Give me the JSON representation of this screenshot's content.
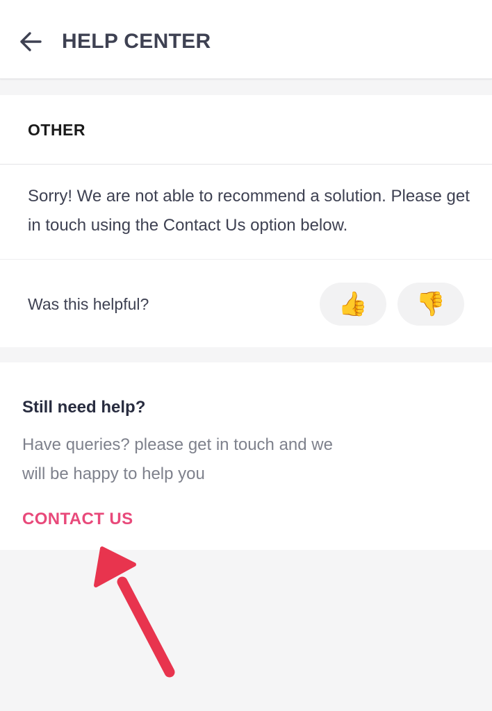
{
  "header": {
    "back_icon": "arrow-left-icon",
    "title": "HELP CENTER"
  },
  "article": {
    "section_title": "OTHER",
    "message": "Sorry! We are not able to recommend a solution. Please get in touch using the Contact Us option below."
  },
  "feedback": {
    "question": "Was this helpful?",
    "thumbs_up_icon": "👍",
    "thumbs_down_icon": "👎"
  },
  "support": {
    "title": "Still need help?",
    "description_line1": "Have queries? please get in touch and we",
    "description_line2": "will be happy to help you",
    "contact_label": "CONTACT US"
  },
  "colors": {
    "accent": "#e8497a",
    "annotation_arrow": "#e8344e",
    "page_background": "#f5f5f6"
  }
}
